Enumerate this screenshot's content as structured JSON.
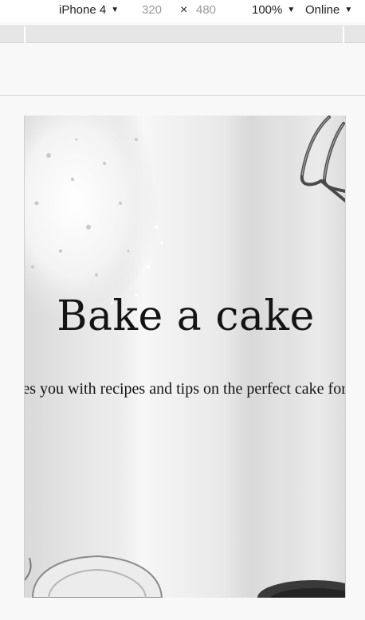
{
  "toolbar": {
    "device": "iPhone 4",
    "width": "320",
    "times": "×",
    "height": "480",
    "zoom": "100%",
    "throttle": "Online",
    "caret": "▼"
  },
  "page": {
    "title": "Bake a cake",
    "subtitle": "de that provides you with recipes and tips on the perfect cake for any occasion."
  },
  "icons": {
    "dropdown": "caret-down-icon",
    "close": "times-icon"
  }
}
